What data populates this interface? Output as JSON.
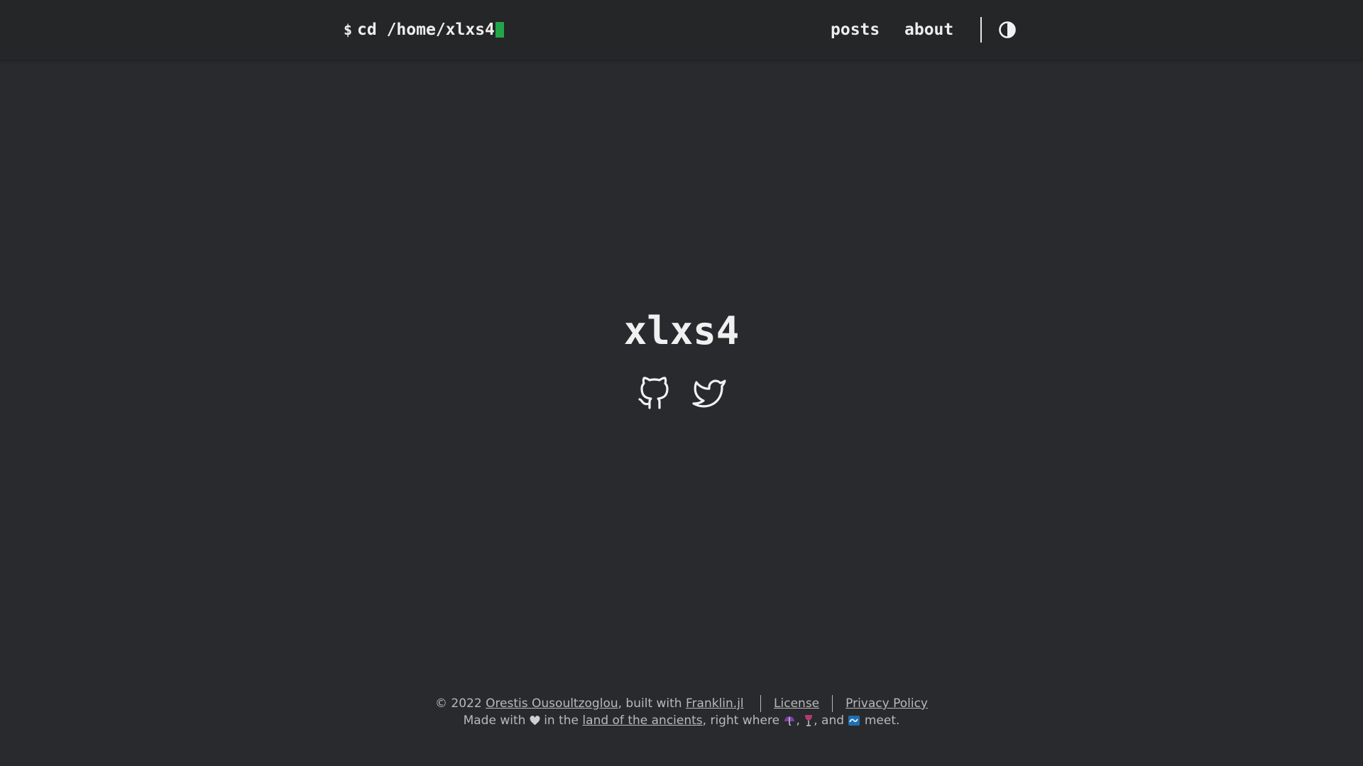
{
  "header": {
    "prompt": "$",
    "logo_text": "cd /home/xlxs4",
    "nav": {
      "posts_label": "posts",
      "about_label": "about"
    },
    "theme_toggle_icon": "contrast-icon"
  },
  "main": {
    "title": "xlxs4",
    "social_icons": [
      "github-icon",
      "twitter-icon"
    ]
  },
  "footer": {
    "copyright_prefix": "© 2022",
    "author_link": "Orestis Ousoultzoglou",
    "built_with_text": ", built with",
    "franklin_link": "Franklin.jl",
    "license_link": "License",
    "privacy_link": "Privacy Policy",
    "made_with_text": "Made with",
    "in_the_text": "in the",
    "land_link": "land of the ancients",
    "right_where_text": ", right where",
    "comma": ",",
    "and_text": ", and",
    "meet_text": "meet."
  },
  "colors": {
    "background": "#292a2d",
    "header_background": "#252627",
    "cursor_accent": "#23a549",
    "text": "#e6e6e6",
    "footer_text": "#b9b9bb"
  }
}
